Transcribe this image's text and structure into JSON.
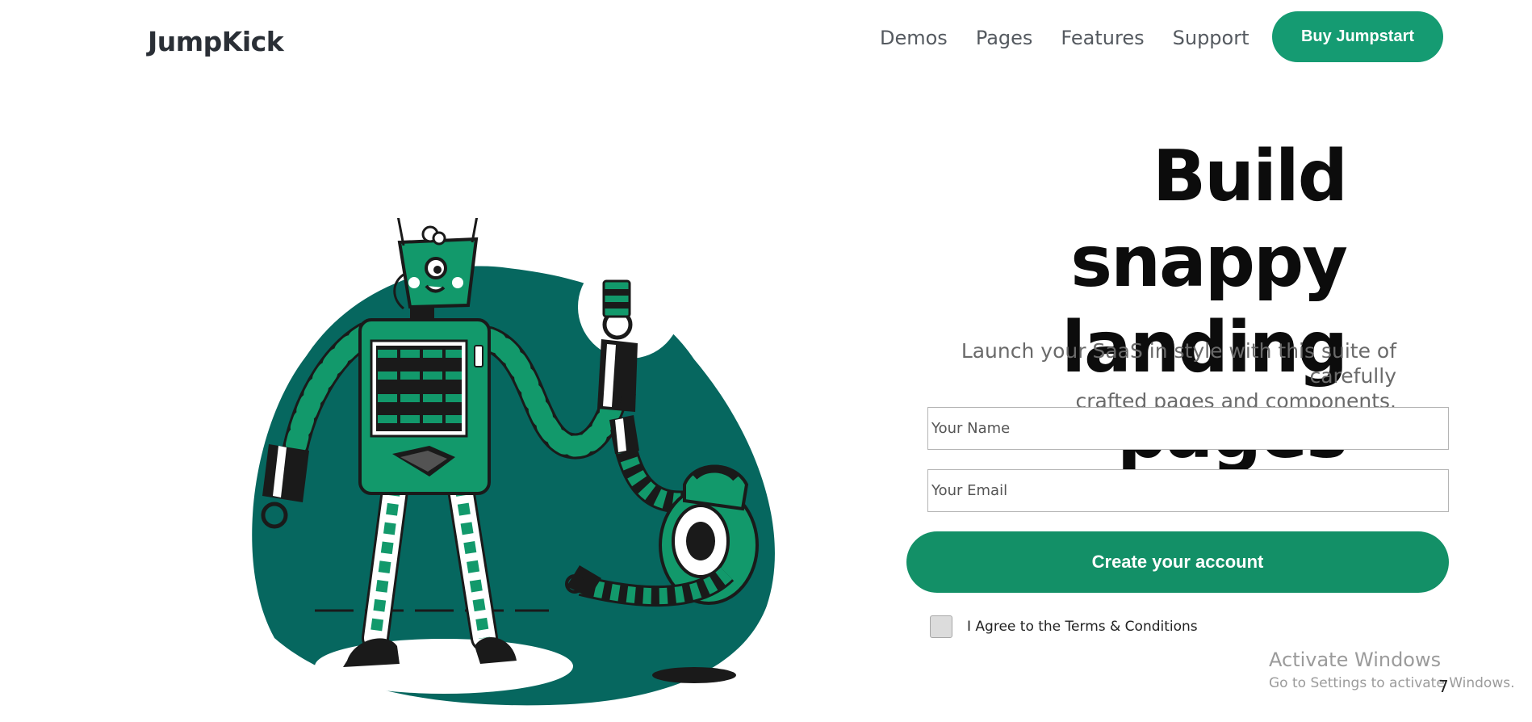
{
  "brand": {
    "name": "JumpKick"
  },
  "nav": {
    "items": [
      "Demos",
      "Pages",
      "Features",
      "Support"
    ],
    "cta": "Buy Jumpstart"
  },
  "hero": {
    "title_line1": "Build snappy",
    "title_line2": "landing pages",
    "subtitle_line1": "Launch your SaaS in style with this suite of carefully",
    "subtitle_line2": "crafted pages and components."
  },
  "form": {
    "name_placeholder": "Your Name",
    "email_placeholder": "Your Email",
    "submit_label": "Create your account",
    "terms_label": "I Agree to the Terms & Conditions",
    "terms_checked": false
  },
  "watermark": {
    "line1": "Activate Windows",
    "line2": "Go to Settings to activate Windows.",
    "stray_mark": "7"
  },
  "colors": {
    "accent": "#159b72",
    "illustration_bg": "#06675f",
    "robot_green": "#12996b"
  },
  "illustration": {
    "icon": "robots-illustration-icon"
  }
}
